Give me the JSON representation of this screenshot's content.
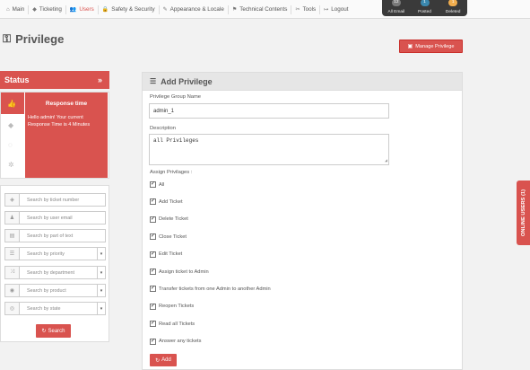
{
  "nav": {
    "items": [
      {
        "icon": "home-icon",
        "glyph": "⌂",
        "label": "Main"
      },
      {
        "icon": "ticket-icon",
        "glyph": "◆",
        "label": "Ticketing"
      },
      {
        "icon": "users-icon",
        "glyph": "👥",
        "label": "Users"
      },
      {
        "icon": "lock-icon",
        "glyph": "🔒",
        "label": "Safety & Security"
      },
      {
        "icon": "brush-icon",
        "glyph": "✎",
        "label": "Appearance & Locale"
      },
      {
        "icon": "flag-icon",
        "glyph": "⚑",
        "label": "Technical Contents"
      },
      {
        "icon": "wrench-icon",
        "glyph": "✂",
        "label": "Tools"
      },
      {
        "icon": "logout-icon",
        "glyph": "↦",
        "label": "Logout"
      }
    ],
    "active_index": 2
  },
  "stats": [
    {
      "label": "All Email",
      "badge": "12",
      "color": "#7a7a7a"
    },
    {
      "label": "Posted",
      "badge": "1",
      "color": "#3a87ad"
    },
    {
      "label": "Deleted",
      "badge": "1",
      "color": "#f0ad4e"
    }
  ],
  "header": {
    "title": "Privilege",
    "manage_button": "Manage Privilege"
  },
  "status": {
    "title": "Status",
    "collapse_glyph": "»",
    "response_title": "Response time",
    "response_text": "Hello admin! Your current Response Time is 4 Minutes"
  },
  "search": {
    "fields": [
      {
        "icon": "tag-icon",
        "glyph": "◈",
        "placeholder": "Search by ticket number",
        "select": false
      },
      {
        "icon": "user-icon",
        "glyph": "♟",
        "placeholder": "Search by user email",
        "select": false
      },
      {
        "icon": "file-icon",
        "glyph": "▤",
        "placeholder": "Search by part of text",
        "select": false
      },
      {
        "icon": "list-icon",
        "glyph": "☰",
        "placeholder": "Search by priority",
        "select": true
      },
      {
        "icon": "sitemap-icon",
        "glyph": "⤨",
        "placeholder": "Search by department",
        "select": true
      },
      {
        "icon": "shield-icon",
        "glyph": "◉",
        "placeholder": "Search by product",
        "select": true
      },
      {
        "icon": "eye-icon",
        "glyph": "◎",
        "placeholder": "Search by state",
        "select": true
      }
    ],
    "button": "Search"
  },
  "form": {
    "panel_title": "Add Privilege",
    "group_name_label": "Privilege Group Name",
    "group_name_value": "admin_1",
    "description_label": "Description",
    "description_value": "all Privileges",
    "assign_label": "Assign Privilages :",
    "privileges": [
      "All",
      "Add Ticket",
      "Delete Ticket",
      "Close Ticket",
      "Edit Ticket",
      "Assign ticket to Admin",
      "Transfer tickets from one Admin to another Admin",
      "Reopen Tickets",
      "Read all Tickets",
      "Answer any tickets"
    ],
    "add_button": "Add"
  },
  "online_users": "ONLINE USERS (1)"
}
